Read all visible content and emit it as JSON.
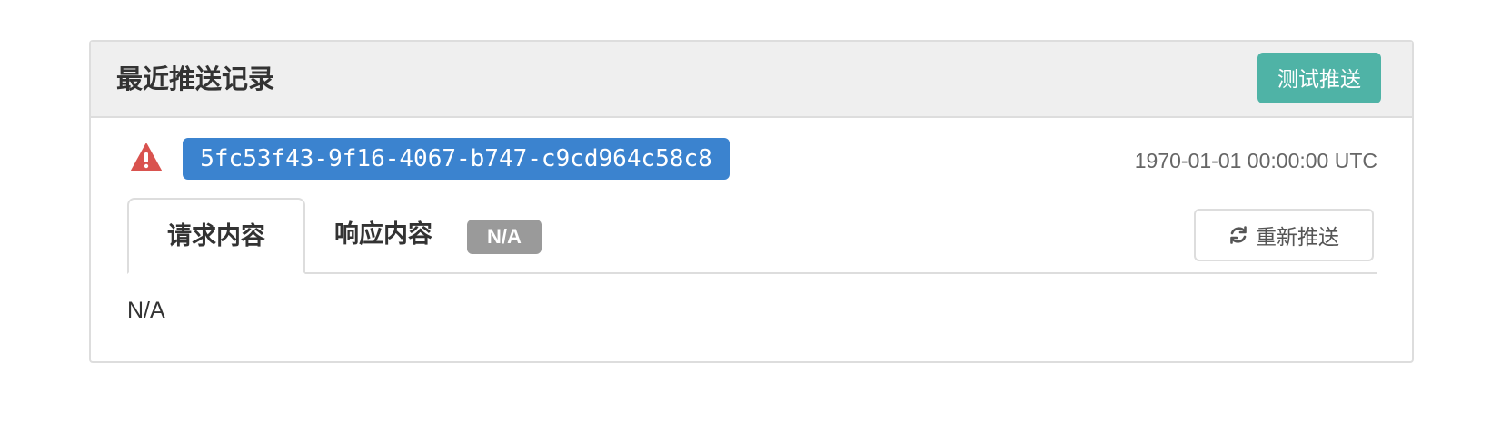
{
  "panel": {
    "title": "最近推送记录",
    "test_push_label": "测试推送"
  },
  "record": {
    "status_icon": "warning-icon",
    "event_id": "5fc53f43-9f16-4067-b747-c9cd964c58c8",
    "timestamp": "1970-01-01 00:00:00 UTC"
  },
  "tabs": [
    {
      "label": "请求内容",
      "active": true
    },
    {
      "label": "响应内容",
      "active": false,
      "badge": "N/A"
    }
  ],
  "resend": {
    "icon": "refresh-icon",
    "label": "重新推送"
  },
  "content": {
    "text": "N/A"
  },
  "colors": {
    "accent_teal": "#4fb3a6",
    "id_blue": "#3b83cf",
    "warning_red": "#d9534f",
    "badge_gray": "#9a9a9a"
  }
}
